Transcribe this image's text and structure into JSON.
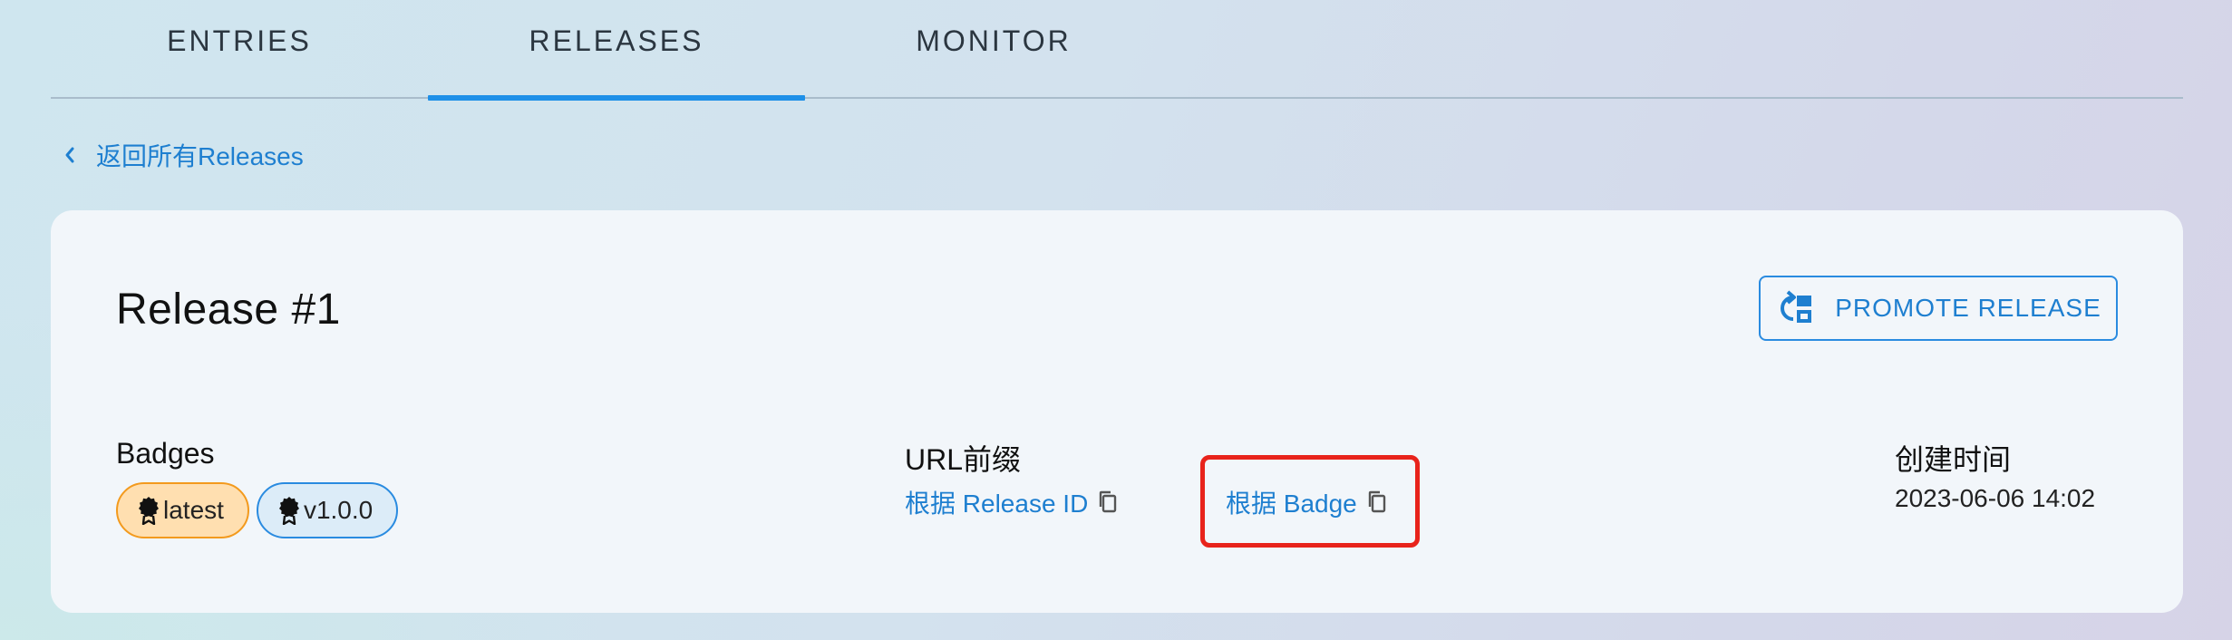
{
  "tabs": [
    {
      "label": "ENTRIES",
      "active": false
    },
    {
      "label": "RELEASES",
      "active": true
    },
    {
      "label": "MONITOR",
      "active": false
    }
  ],
  "back_link": {
    "label": "返回所有Releases",
    "icon": "chevron-left-icon"
  },
  "release": {
    "title": "Release #1",
    "promote_button": "PROMOTE RELEASE",
    "badges_label": "Badges",
    "badges": [
      {
        "name": "latest",
        "icon": "badge-icon",
        "color": "#f39a1d"
      },
      {
        "name": "v1.0.0",
        "icon": "badge-icon",
        "color": "#2a8be0"
      }
    ],
    "url_prefix_label": "URL前缀",
    "url_links": [
      {
        "label": "根据 Release ID",
        "icon": "copy-icon"
      },
      {
        "label": "根据 Badge",
        "icon": "copy-icon",
        "highlighted": true
      }
    ],
    "created_label": "创建时间",
    "created_value": "2023-06-06 14:02"
  },
  "colors": {
    "accent": "#1e90e8",
    "highlight": "#e8231b"
  }
}
